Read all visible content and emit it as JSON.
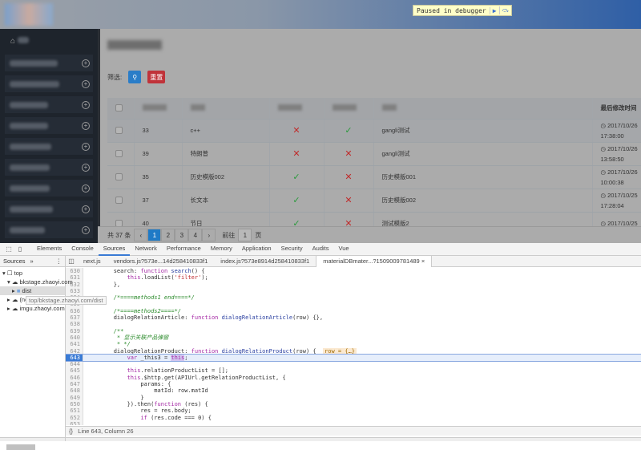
{
  "debugger": {
    "paused_label": "Paused in debugger",
    "resume_icon": "resume-icon",
    "step_over_icon": "step-over-icon"
  },
  "sidebar": {
    "home_icon": "home-icon",
    "item_count": 9
  },
  "main": {
    "filter_label": "筛选:",
    "search_icon": "search-icon",
    "reset_label": "重置",
    "table": {
      "last_modified_header": "最后修改时间",
      "rows": [
        {
          "id": "33",
          "name": "c++",
          "col3": "x",
          "col4": "check",
          "template": "gangli测试",
          "date": "2017/10/26",
          "time": "17:38:00"
        },
        {
          "id": "39",
          "name": "特朗普",
          "col3": "x",
          "col4": "x",
          "template": "gangli测试",
          "date": "2017/10/26",
          "time": "13:58:50"
        },
        {
          "id": "35",
          "name": "历史模版002",
          "col3": "check",
          "col4": "x",
          "template": "历史模版001",
          "date": "2017/10/26",
          "time": "10:00:38"
        },
        {
          "id": "37",
          "name": "长文本",
          "col3": "check",
          "col4": "x",
          "template": "历史模版002",
          "date": "2017/10/25",
          "time": "17:28:04"
        },
        {
          "id": "40",
          "name": "节日",
          "col3": "check",
          "col4": "x",
          "template": "测试模版2",
          "date": "2017/10/25",
          "time": ""
        }
      ]
    },
    "pagination": {
      "total": "共 37 条",
      "pages": [
        "1",
        "2",
        "3",
        "4"
      ],
      "current": "1",
      "goto_label": "前往",
      "goto_value": "1",
      "page_suffix": "页"
    }
  },
  "devtools": {
    "tabs": [
      "Elements",
      "Console",
      "Sources",
      "Network",
      "Performance",
      "Memory",
      "Application",
      "Security",
      "Audits",
      "Vue"
    ],
    "active_tab": "Sources",
    "left_header": "Sources",
    "more": "»",
    "tree": [
      "top",
      "bkstage.zhaoyi.com",
      "dist",
      "(no domain)",
      "imgu.zhaoyi.com"
    ],
    "tooltip": "top/bkstage.zhaoyi.com/dist",
    "files": [
      "next.js",
      "vendors.js?573e...14d258410833f1",
      "index.js?573e8914d258410833f1",
      "materialDBmater...?1509009781489"
    ],
    "close": "×",
    "status": "Line 643, Column 26",
    "format_icon": "{}"
  }
}
